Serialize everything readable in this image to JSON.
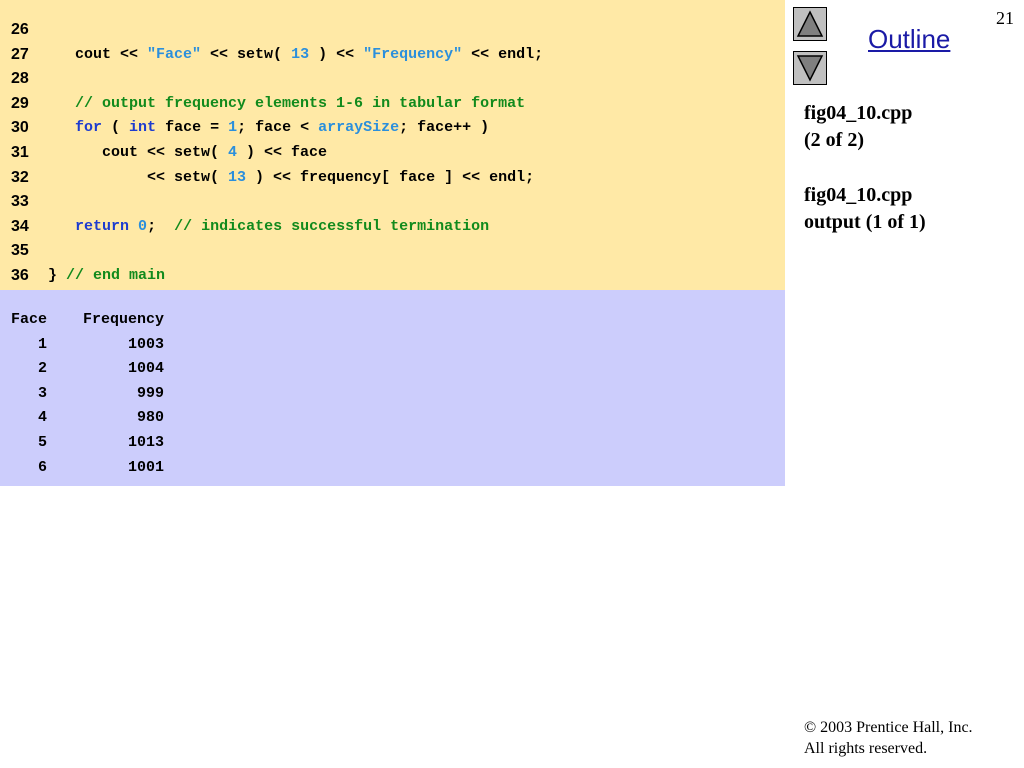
{
  "slide": {
    "number": "21"
  },
  "nav": {
    "outline_label": "Outline"
  },
  "sidebar": {
    "file1_name": "fig04_10.cpp",
    "file1_part": "(2 of 2)",
    "file2_name": "fig04_10.cpp",
    "file2_part": "output (1 of 1)"
  },
  "code": {
    "lines": [
      {
        "n": "26",
        "tokens": []
      },
      {
        "n": "27",
        "tokens": [
          {
            "t": "   cout << ",
            "c": ""
          },
          {
            "t": "\"Face\"",
            "c": "str"
          },
          {
            "t": " << setw( ",
            "c": ""
          },
          {
            "t": "13",
            "c": "num"
          },
          {
            "t": " ) << ",
            "c": ""
          },
          {
            "t": "\"Frequency\"",
            "c": "str"
          },
          {
            "t": " << endl;",
            "c": ""
          }
        ]
      },
      {
        "n": "28",
        "tokens": []
      },
      {
        "n": "29",
        "tokens": [
          {
            "t": "   ",
            "c": ""
          },
          {
            "t": "// output frequency elements 1-6 in tabular format",
            "c": "com"
          }
        ]
      },
      {
        "n": "30",
        "tokens": [
          {
            "t": "   ",
            "c": ""
          },
          {
            "t": "for",
            "c": "kw"
          },
          {
            "t": " ( ",
            "c": ""
          },
          {
            "t": "int",
            "c": "kw"
          },
          {
            "t": " face = ",
            "c": ""
          },
          {
            "t": "1",
            "c": "num"
          },
          {
            "t": "; face < ",
            "c": ""
          },
          {
            "t": "arraySize",
            "c": "id"
          },
          {
            "t": "; face++ )",
            "c": ""
          }
        ]
      },
      {
        "n": "31",
        "tokens": [
          {
            "t": "      cout << setw( ",
            "c": ""
          },
          {
            "t": "4",
            "c": "num"
          },
          {
            "t": " ) << face",
            "c": ""
          }
        ]
      },
      {
        "n": "32",
        "tokens": [
          {
            "t": "           << setw( ",
            "c": ""
          },
          {
            "t": "13",
            "c": "num"
          },
          {
            "t": " ) << frequency[ face ] << endl;",
            "c": ""
          }
        ]
      },
      {
        "n": "33",
        "tokens": []
      },
      {
        "n": "34",
        "tokens": [
          {
            "t": "   ",
            "c": ""
          },
          {
            "t": "return",
            "c": "kw"
          },
          {
            "t": " ",
            "c": ""
          },
          {
            "t": "0",
            "c": "num"
          },
          {
            "t": ";  ",
            "c": ""
          },
          {
            "t": "// indicates successful termination",
            "c": "com"
          }
        ]
      },
      {
        "n": "35",
        "tokens": []
      },
      {
        "n": "36",
        "tokens": [
          {
            "t": "} ",
            "c": ""
          },
          {
            "t": "// end main",
            "c": "com"
          }
        ]
      }
    ]
  },
  "output": {
    "lines": [
      "Face    Frequency",
      "   1         1003",
      "   2         1004",
      "   3          999",
      "   4          980",
      "   5         1013",
      "   6         1001"
    ]
  },
  "footer": {
    "copyright_symbol": "©",
    "copyright": " 2003 Prentice Hall, Inc.",
    "rights": "All rights reserved."
  },
  "colors": {
    "code_bg": "#ffe9a6",
    "output_bg": "#cccdfc",
    "string": "#2b8fdc",
    "keyword": "#1d3ccf",
    "comment": "#118a1c",
    "link": "#1a1aa6"
  }
}
